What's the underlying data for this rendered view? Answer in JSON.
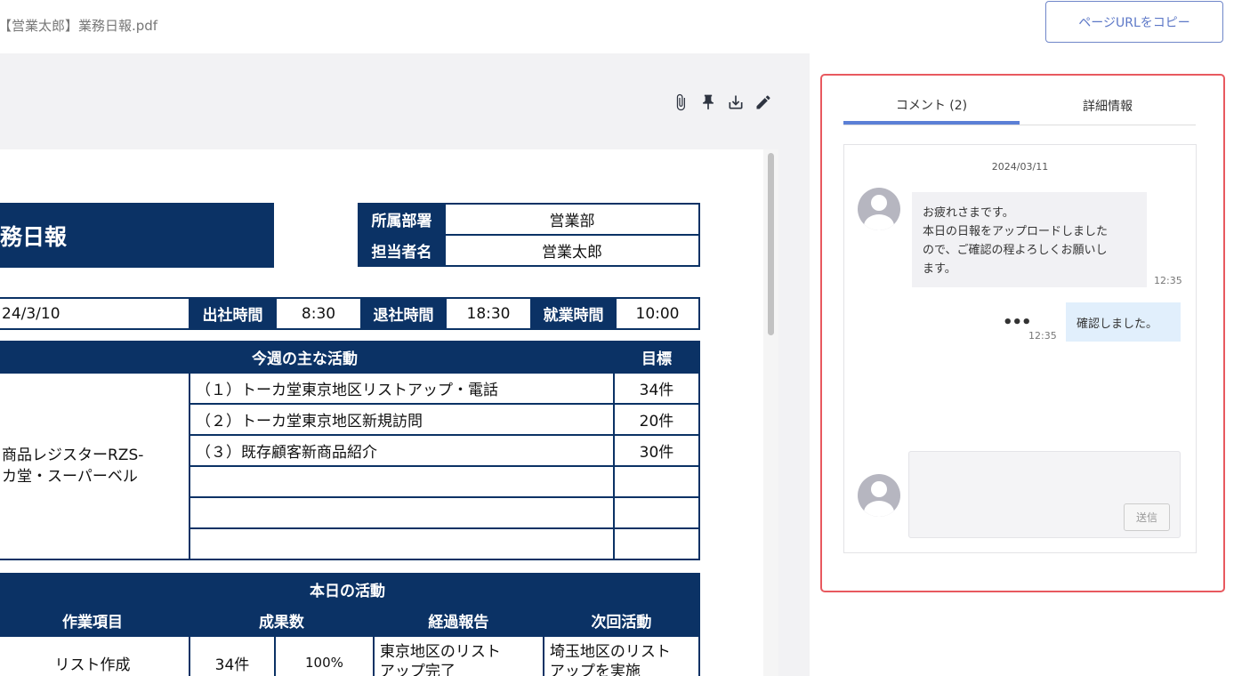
{
  "header": {
    "file_title": "【営業太郎】業務日報.pdf",
    "copy_button": "ページURLをコピー"
  },
  "toolbar": {
    "icons": [
      "paperclip-icon",
      "pin-icon",
      "download-icon",
      "edit-icon"
    ]
  },
  "document": {
    "title": "務日報",
    "dept_label": "所属部署",
    "dept_value": "営業部",
    "person_label": "担当者名",
    "person_value": "営業太郎",
    "date_value": "24/3/10",
    "arrive_label": "出社時間",
    "arrive_value": "8:30",
    "leave_label": "退社時間",
    "leave_value": "18:30",
    "work_label": "就業時間",
    "work_value": "10:00",
    "weekly_header": "今週の主な活動",
    "goal_header": "目標",
    "weekly_left_line1": "商品レジスターRZS-",
    "weekly_left_line2": "カ堂・スーパーベル",
    "weekly_rows": [
      {
        "activity": "（１）トーカ堂東京地区リストアップ・電話",
        "goal": "34件"
      },
      {
        "activity": "（２）トーカ堂東京地区新規訪問",
        "goal": "20件"
      },
      {
        "activity": "（３）既存顧客新商品紹介",
        "goal": "30件"
      },
      {
        "activity": "",
        "goal": ""
      },
      {
        "activity": "",
        "goal": ""
      },
      {
        "activity": "",
        "goal": ""
      }
    ],
    "today_header": "本日の活動",
    "today_cols": [
      "作業項目",
      "成果数",
      "経過報告",
      "次回活動"
    ],
    "today_row": {
      "item": "リスト作成",
      "count": "34件",
      "percent": "100%",
      "report": "東京地区のリスト",
      "report2": "アップ完了",
      "next": "埼玉地区のリスト",
      "next2": "アップを実施"
    }
  },
  "side_panel": {
    "tabs": [
      {
        "label": "コメント (2)",
        "active": true
      },
      {
        "label": "詳細情報",
        "active": false
      }
    ],
    "date": "2024/03/11",
    "comments": [
      {
        "text": "お疲れさまです。\n本日の日報をアップロードしました\nので、ご確認の程よろしくお願いし\nます。",
        "time": "12:35"
      },
      {
        "text": "確認しました。",
        "time": "12:35"
      }
    ],
    "send_button": "送信"
  }
}
